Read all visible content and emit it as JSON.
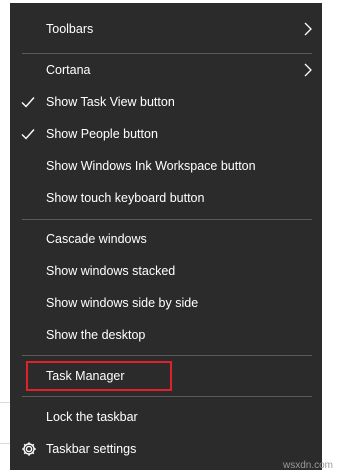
{
  "menu": {
    "items": [
      {
        "label": "Toolbars",
        "check": false,
        "submenu": true
      },
      {
        "label": "Cortana",
        "check": false,
        "submenu": true
      },
      {
        "label": "Show Task View button",
        "check": true,
        "submenu": false
      },
      {
        "label": "Show People button",
        "check": true,
        "submenu": false
      },
      {
        "label": "Show Windows Ink Workspace button",
        "check": false,
        "submenu": false
      },
      {
        "label": "Show touch keyboard button",
        "check": false,
        "submenu": false
      },
      {
        "label": "Cascade windows",
        "check": false,
        "submenu": false
      },
      {
        "label": "Show windows stacked",
        "check": false,
        "submenu": false
      },
      {
        "label": "Show windows side by side",
        "check": false,
        "submenu": false
      },
      {
        "label": "Show the desktop",
        "check": false,
        "submenu": false
      },
      {
        "label": "Task Manager",
        "check": false,
        "submenu": false,
        "highlighted": true
      },
      {
        "label": "Lock the taskbar",
        "check": false,
        "submenu": false
      },
      {
        "label": "Taskbar settings",
        "check": false,
        "submenu": false,
        "icon": "gear-icon"
      }
    ]
  },
  "colors": {
    "menu_background": "#2b2b2b",
    "text": "#ffffff",
    "separator": "#5a5a5a",
    "highlight_border": "#e0202a"
  },
  "watermark": "wsxdn.com"
}
